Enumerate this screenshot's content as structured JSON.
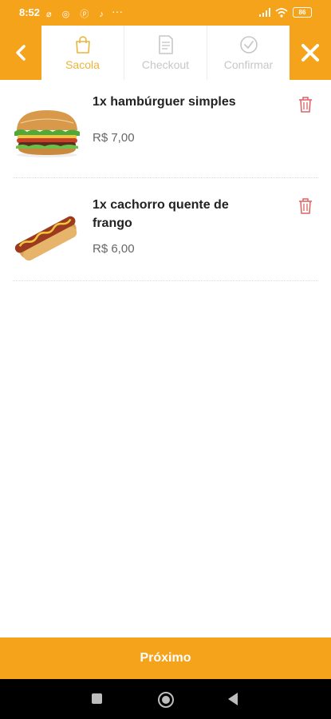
{
  "status_bar": {
    "time": "8:52",
    "left_icons": "⌀ ◎ ⓟ ♪",
    "more": "···",
    "battery": "86"
  },
  "header": {
    "steps": [
      {
        "label": "Sacola",
        "icon": "bag-icon",
        "active": true
      },
      {
        "label": "Checkout",
        "icon": "document-icon",
        "active": false
      },
      {
        "label": "Confirmar",
        "icon": "check-circle-icon",
        "active": false
      }
    ]
  },
  "cart": {
    "items": [
      {
        "name": "1x hambúrguer simples",
        "price": "R$ 7,00",
        "image": "hamburger-image"
      },
      {
        "name": "1x cachorro quente de frango",
        "price": "R$ 6,00",
        "image": "hotdog-image"
      }
    ]
  },
  "footer": {
    "next_label": "Próximo"
  },
  "colors": {
    "accent": "#f5a31a",
    "active_step": "#e9b53a",
    "delete": "#e06060"
  }
}
